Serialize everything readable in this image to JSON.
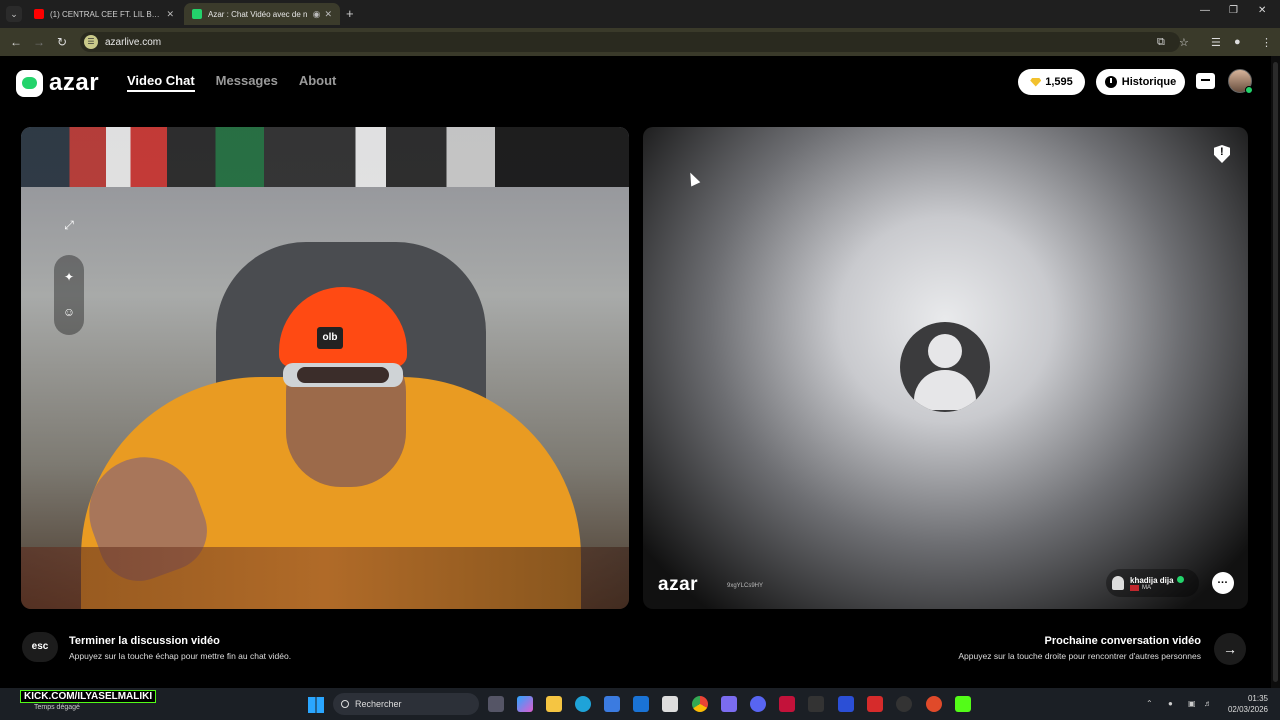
{
  "browser": {
    "tabs": [
      {
        "title": "(1) CENTRAL CEE FT. LIL BABY -",
        "favicon_color": "#ff0000",
        "active": false
      },
      {
        "title": "Azar : Chat Vidéo avec de n",
        "favicon_color": "#23d36b",
        "active": true
      }
    ],
    "url": "azarlive.com"
  },
  "app": {
    "brand": "azar",
    "nav": [
      {
        "label": "Video Chat",
        "active": true
      },
      {
        "label": "Messages",
        "active": false
      },
      {
        "label": "About",
        "active": false
      }
    ],
    "gems": "1,595",
    "history_label": "Historique"
  },
  "self_video": {
    "beanie_text": "olb"
  },
  "remote": {
    "watermark": "azar",
    "watermark_id": "9xgYLCs9HY",
    "peer_name": "khadija dija",
    "peer_country": "MA"
  },
  "controls": {
    "esc_key": "esc",
    "end_title": "Terminer la discussion vidéo",
    "end_subtitle": "Appuyez sur la touche échap pour mettre fin au chat vidéo.",
    "next_title": "Prochaine conversation vidéo",
    "next_subtitle": "Appuyez sur la touche droite pour rencontrer d'autres personnes"
  },
  "taskbar": {
    "overlay_text": "KICK.COM/ILYASELMALIKI",
    "weather": "Temps dégagé",
    "search_placeholder": "Rechercher",
    "time": "01:35",
    "date": "02/03/2026"
  },
  "colors": {
    "accent": "#23d36b",
    "gem": "#f2c12e"
  }
}
